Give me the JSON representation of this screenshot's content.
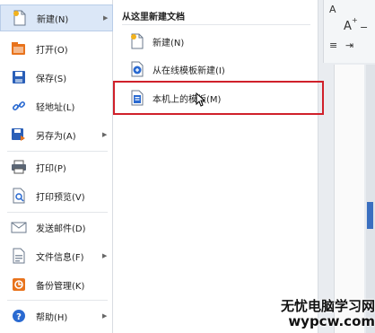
{
  "left_menu": {
    "items": [
      {
        "label": "新建(N)",
        "icon": "new-document-icon",
        "has_arrow": true,
        "active": true
      },
      {
        "label": "打开(O)",
        "icon": "open-folder-icon",
        "has_arrow": false
      },
      {
        "label": "保存(S)",
        "icon": "save-icon",
        "has_arrow": false
      },
      {
        "label": "轻地址(L)",
        "icon": "link-icon",
        "has_arrow": false
      },
      {
        "label": "另存为(A)",
        "icon": "save-as-icon",
        "has_arrow": true
      },
      {
        "label": "打印(P)",
        "icon": "print-icon",
        "has_arrow": false
      },
      {
        "label": "打印预览(V)",
        "icon": "print-preview-icon",
        "has_arrow": false
      },
      {
        "label": "发送邮件(D)",
        "icon": "mail-icon",
        "has_arrow": false
      },
      {
        "label": "文件信息(F)",
        "icon": "file-info-icon",
        "has_arrow": true
      },
      {
        "label": "备份管理(K)",
        "icon": "backup-icon",
        "has_arrow": false
      },
      {
        "label": "帮助(H)",
        "icon": "help-icon",
        "has_arrow": true
      }
    ]
  },
  "submenu": {
    "title": "从这里新建文档",
    "items": [
      {
        "label": "新建(N)",
        "icon": "blank-document-icon"
      },
      {
        "label": "从在线模板新建(I)",
        "icon": "online-template-icon"
      },
      {
        "label": "本机上的模板(M)",
        "icon": "local-template-icon",
        "highlighted": true
      }
    ]
  },
  "toolbar": {
    "glyph_a": "A",
    "glyph_a_small": "A",
    "glyph_sup": "+",
    "glyph_minus": "−"
  },
  "watermark": {
    "line1": "无忧电脑学习网",
    "line2": "wypcw.com"
  },
  "colors": {
    "active_bg": "#dbe7f7",
    "highlight_border": "#d0202a",
    "accent_blue": "#2a6ad1",
    "accent_orange": "#e8731c"
  }
}
